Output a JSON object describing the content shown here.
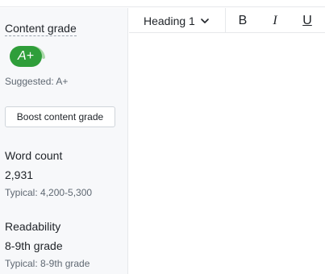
{
  "sidebar": {
    "content_grade": {
      "title": "Content grade",
      "grade": "A+",
      "suggested": "Suggested: A+",
      "boost_label": "Boost content grade",
      "grade_color": "#2f9e3a"
    },
    "word_count": {
      "title": "Word count",
      "value": "2,931",
      "typical": "Typical: 4,200-5,300"
    },
    "readability": {
      "title": "Readability",
      "value": "8-9th grade",
      "typical": "Typical: 8-9th grade"
    }
  },
  "toolbar": {
    "heading_select": "Heading 1",
    "bold_label": "B",
    "italic_label": "I",
    "underline_label": "U",
    "icons": {
      "heading_chevron": "chevron-down-icon"
    }
  }
}
